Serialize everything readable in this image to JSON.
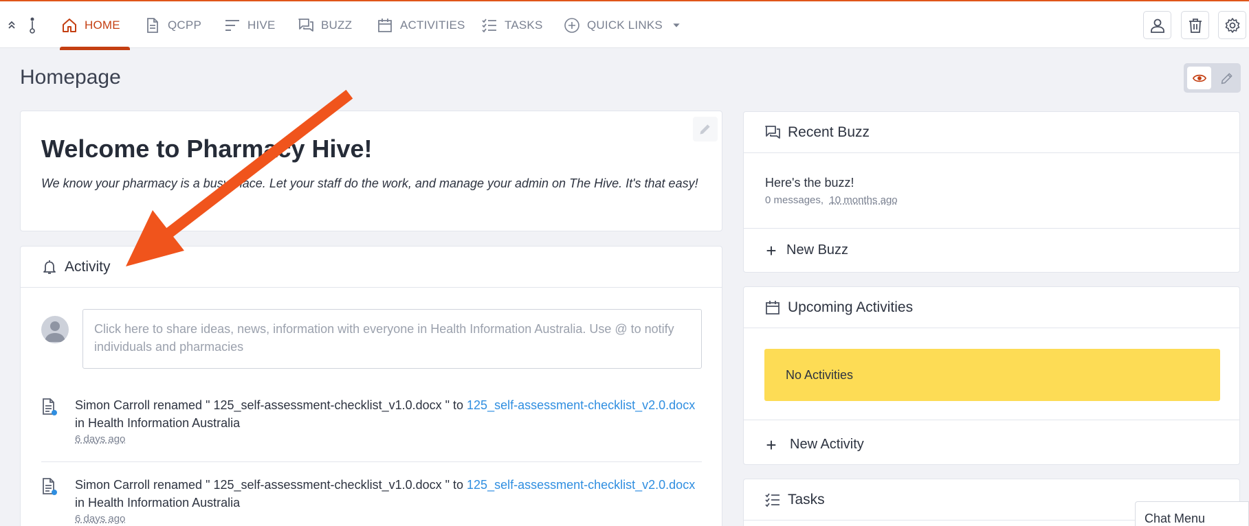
{
  "colors": {
    "accent": "#c43f12",
    "top_border": "#e0561a",
    "annotation_arrow": "#f0541c",
    "link": "#2f8ee0",
    "warning": "#fddc55"
  },
  "nav": {
    "items": [
      {
        "label": "HOME",
        "icon": "home-icon",
        "active": true
      },
      {
        "label": "QCPP",
        "icon": "document-icon"
      },
      {
        "label": "HIVE",
        "icon": "lines-icon"
      },
      {
        "label": "BUZZ",
        "icon": "chat-bubbles-icon"
      },
      {
        "label": "ACTIVITIES",
        "icon": "calendar-icon"
      },
      {
        "label": "TASKS",
        "icon": "checklist-icon"
      },
      {
        "label": "QUICK LINKS",
        "icon": "plus-circle-icon",
        "dropdown": true
      }
    ],
    "right_icons": [
      "user-icon",
      "trash-icon",
      "gear-icon"
    ]
  },
  "page": {
    "title": "Homepage",
    "view_toggle": [
      "eye-icon",
      "pencil-icon"
    ]
  },
  "welcome": {
    "title": "Welcome to Pharmacy Hive!",
    "text": "We know your pharmacy is a busy place. Let your staff do the work, and manage your admin on The Hive. It's that easy!"
  },
  "activity": {
    "title": "Activity",
    "placeholder": "Click here to share ideas, news, information with everyone in Health Information Australia. Use @ to notify individuals and pharmacies",
    "items": [
      {
        "text": "Simon Carroll renamed \" 125_self-assessment-checklist_v1.0.docx \" to ",
        "link": "125_self-assessment-checklist_v2.0.docx",
        "suffix": "in Health Information Australia",
        "time": "6 days ago"
      },
      {
        "text": "Simon Carroll renamed \" 125_self-assessment-checklist_v1.0.docx \" to ",
        "link": "125_self-assessment-checklist_v2.0.docx",
        "suffix": "in Health Information Australia",
        "time": "6 days ago"
      }
    ]
  },
  "recent_buzz": {
    "title": "Recent Buzz",
    "item_title": "Here's the buzz!",
    "messages": "0 messages,",
    "time": "10 months ago",
    "new_label": "New Buzz"
  },
  "upcoming": {
    "title": "Upcoming Activities",
    "empty": "No Activities",
    "new_label": "New Activity"
  },
  "tasks": {
    "title": "Tasks"
  },
  "chat": {
    "label": "Chat Menu"
  }
}
